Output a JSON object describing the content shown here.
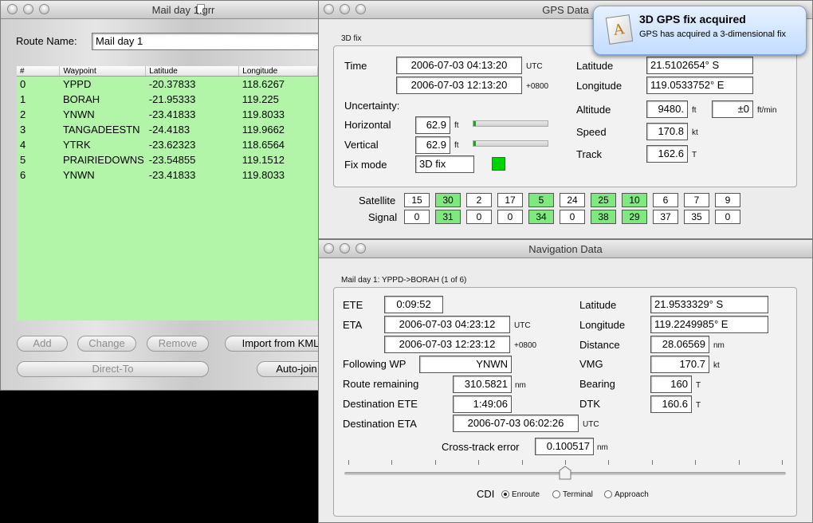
{
  "route_window": {
    "title": "Mail day 1.grr",
    "route_name_label": "Route Name:",
    "route_name_value": "Mail day 1",
    "columns": [
      "#",
      "Waypoint",
      "Latitude",
      "Longitude"
    ],
    "rows": [
      [
        "0",
        "YPPD",
        "-20.37833",
        "118.6267"
      ],
      [
        "1",
        "BORAH",
        "-21.95333",
        "119.225"
      ],
      [
        "2",
        "YNWN",
        "-23.41833",
        "119.8033"
      ],
      [
        "3",
        "TANGADEESTN",
        "-24.4183",
        "119.9662"
      ],
      [
        "4",
        "YTRK",
        "-23.62323",
        "118.6564"
      ],
      [
        "5",
        "PRAIRIEDOWNS",
        "-23.54855",
        "119.1512"
      ],
      [
        "6",
        "YNWN",
        "-23.41833",
        "119.8033"
      ]
    ],
    "buttons": {
      "add": "Add",
      "change": "Change",
      "remove": "Remove",
      "import": "Import from KML",
      "direct_to": "Direct-To",
      "auto_join": "Auto-join"
    },
    "list_color": "#b3f5a8"
  },
  "gps_window": {
    "title": "GPS Data",
    "group_label": "3D fix",
    "time_label": "Time",
    "time_utc": "2006-07-03 04:13:20",
    "time_utc_unit": "UTC",
    "time_local": "2006-07-03 12:13:20",
    "time_local_unit": "+0800",
    "uncertainty_label": "Uncertainty:",
    "horizontal_label": "Horizontal",
    "horizontal_value": "62.9",
    "horizontal_unit": "ft",
    "horizontal_level": 0.03,
    "vertical_label": "Vertical",
    "vertical_value": "62.9",
    "vertical_unit": "ft",
    "vertical_level": 0.03,
    "fixmode_label": "Fix mode",
    "fixmode_value": "3D fix",
    "fix_indicator_color": "#00d400",
    "latitude_label": "Latitude",
    "latitude_value": "21.5102654° S",
    "longitude_label": "Longitude",
    "longitude_value": "119.0533752° E",
    "altitude_label": "Altitude",
    "altitude_value": "9480.",
    "altitude_unit": "ft",
    "climb_value": "±0",
    "climb_unit": "ft/min",
    "speed_label": "Speed",
    "speed_value": "170.8",
    "speed_unit": "kt",
    "track_label": "Track",
    "track_value": "162.6",
    "track_unit": "T",
    "satellite_label": "Satellite",
    "signal_label": "Signal",
    "satellites": [
      {
        "sat": "15",
        "signal": "0",
        "active": false
      },
      {
        "sat": "30",
        "signal": "31",
        "active": true
      },
      {
        "sat": "2",
        "signal": "0",
        "active": false
      },
      {
        "sat": "17",
        "signal": "0",
        "active": false
      },
      {
        "sat": "5",
        "signal": "34",
        "active": true
      },
      {
        "sat": "24",
        "signal": "0",
        "active": false
      },
      {
        "sat": "25",
        "signal": "38",
        "active": true
      },
      {
        "sat": "10",
        "signal": "29",
        "active": true
      },
      {
        "sat": "6",
        "signal": "37",
        "active": false
      },
      {
        "sat": "7",
        "signal": "35",
        "active": false
      },
      {
        "sat": "9",
        "signal": "0",
        "active": false
      }
    ]
  },
  "notification": {
    "title": "3D GPS fix acquired",
    "body": "GPS has acquired a 3-dimensional fix"
  },
  "nav_window": {
    "title": "Navigation Data",
    "group_label": "Mail day 1: YPPD->BORAH (1 of 6)",
    "ete_label": "ETE",
    "ete_value": "0:09:52",
    "eta_label": "ETA",
    "eta_utc": "2006-07-03 04:23:12",
    "eta_utc_unit": "UTC",
    "eta_local": "2006-07-03 12:23:12",
    "eta_local_unit": "+0800",
    "following_label": "Following WP",
    "following_value": "YNWN",
    "route_remaining_label": "Route remaining",
    "route_remaining_value": "310.5821",
    "route_remaining_unit": "nm",
    "dest_ete_label": "Destination ETE",
    "dest_ete_value": "1:49:06",
    "dest_eta_label": "Destination ETA",
    "dest_eta_value": "2006-07-03 06:02:26",
    "dest_eta_unit": "UTC",
    "latitude_label": "Latitude",
    "latitude_value": "21.9533329° S",
    "longitude_label": "Longitude",
    "longitude_value": "119.2249985° E",
    "distance_label": "Distance",
    "distance_value": "28.06569",
    "distance_unit": "nm",
    "vmg_label": "VMG",
    "vmg_value": "170.7",
    "vmg_unit": "kt",
    "bearing_label": "Bearing",
    "bearing_value": "160",
    "bearing_unit": "T",
    "dtk_label": "DTK",
    "dtk_value": "160.6",
    "dtk_unit": "T",
    "xte_label": "Cross-track error",
    "xte_value": "0.100517",
    "xte_unit": "nm",
    "cdi_position": 0.5,
    "cdi_label": "CDI",
    "cdi_options": [
      "Enroute",
      "Terminal",
      "Approach"
    ],
    "cdi_selected": 0
  }
}
